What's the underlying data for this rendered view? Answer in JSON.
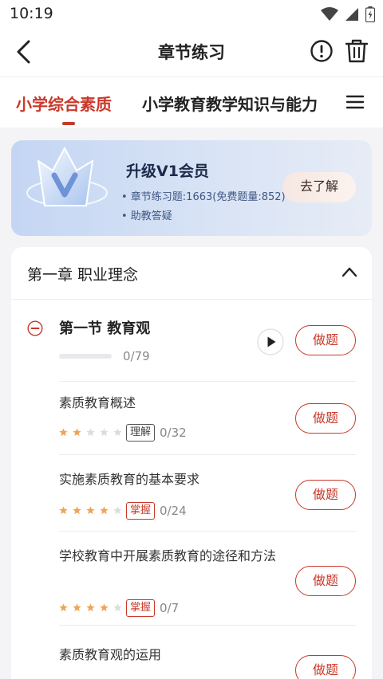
{
  "status": {
    "time": "10:19"
  },
  "nav": {
    "title": "章节练习"
  },
  "tabs": {
    "active": "小学综合素质",
    "other": "小学教育教学知识与能力"
  },
  "vip": {
    "title": "升级V1会员",
    "features": [
      "• 章节练习题:1663(免费题量:852)",
      "• 助教答疑"
    ],
    "button": "去了解"
  },
  "chapter": {
    "title": "第一章 职业理念",
    "section": {
      "title": "第一节 教育观",
      "count": "0/79",
      "button": "做题"
    },
    "items": [
      {
        "title": "素质教育概述",
        "stars": 2,
        "tag": "理解",
        "tag_type": "understand",
        "count": "0/32",
        "button": "做题"
      },
      {
        "title": "实施素质教育的基本要求",
        "stars": 4,
        "tag": "掌握",
        "tag_type": "master",
        "count": "0/24",
        "button": "做题"
      },
      {
        "title": "学校教育中开展素质教育的途径和方法",
        "stars": 4,
        "tag": "掌握",
        "tag_type": "master",
        "count": "0/7",
        "button": "做题"
      },
      {
        "title": "素质教育观的运用",
        "button": "做题"
      }
    ]
  },
  "colors": {
    "accent": "#c9382a",
    "star_on": "#f0a455",
    "star_off": "#dcdcdc"
  }
}
